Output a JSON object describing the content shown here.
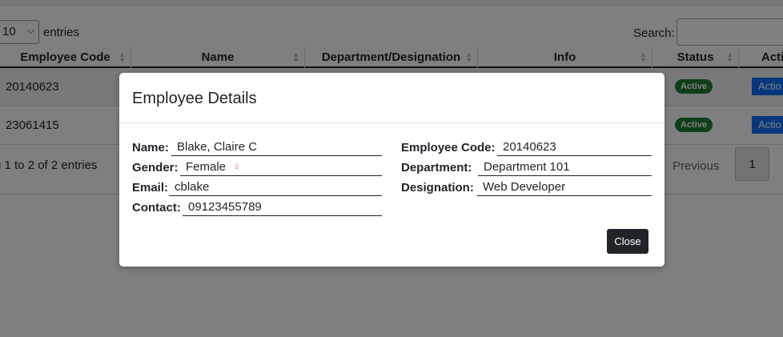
{
  "controls": {
    "length_value": "10",
    "entries_label": "entries",
    "search_label": "Search:"
  },
  "table": {
    "columns": [
      "Employee Code",
      "Name",
      "Department/Designation",
      "Info",
      "Status",
      "Acti"
    ],
    "rows": [
      {
        "code": "20140623",
        "status": "Active",
        "action": "Actio"
      },
      {
        "code": "23061415",
        "status": "Active",
        "action": "Actio"
      }
    ]
  },
  "footer": {
    "info": "g 1 to 2 of 2 entries",
    "previous": "Previous",
    "page": "1"
  },
  "modal": {
    "title": "Employee Details",
    "left": [
      {
        "label": "Name:",
        "value": "Blake, Claire C"
      },
      {
        "label": "Gender:",
        "value": "Female"
      },
      {
        "label": "Email:",
        "value": "cblake"
      },
      {
        "label": "Contact:",
        "value": "09123455789"
      }
    ],
    "right": [
      {
        "label": "Employee Code:",
        "value": "20140623"
      },
      {
        "label": "Department:",
        "value": "Department 101"
      },
      {
        "label": "Designation:",
        "value": "Web Developer"
      }
    ],
    "gender_icon": "female-symbol-icon",
    "close_label": "Close"
  },
  "colors": {
    "status_active": "#1e7e34",
    "action_primary": "#0d6efd",
    "close_button": "#212529",
    "gender_icon": "#f08080"
  }
}
